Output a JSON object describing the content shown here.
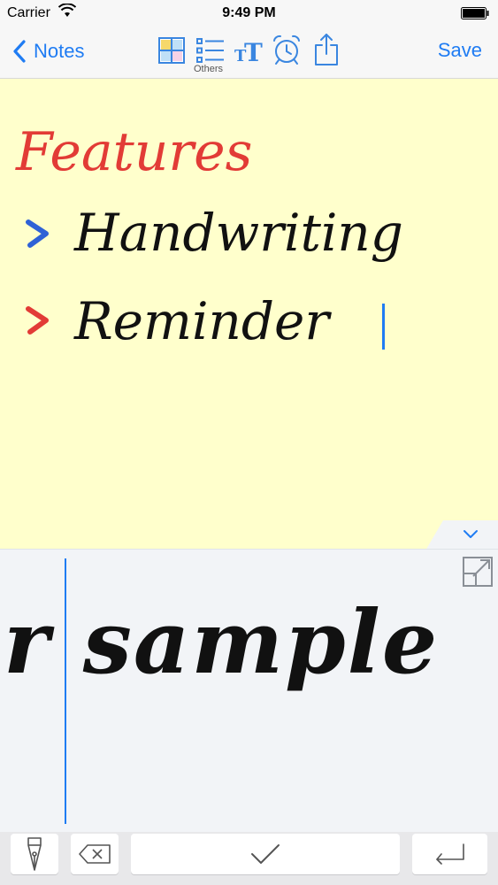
{
  "status_bar": {
    "carrier": "Carrier",
    "time": "9:49 PM"
  },
  "nav": {
    "back_label": "Notes",
    "others_label": "Others",
    "save_label": "Save"
  },
  "note": {
    "title": "Features",
    "items": [
      {
        "text": "Handwriting",
        "bullet_color": "#2f62d6"
      },
      {
        "text": "Reminder",
        "bullet_color": "#e23b36"
      }
    ]
  },
  "pad": {
    "text": "r sample"
  },
  "colors": {
    "accent": "#1f7cf3",
    "note_bg": "#ffffcc",
    "title": "#e23b36"
  }
}
